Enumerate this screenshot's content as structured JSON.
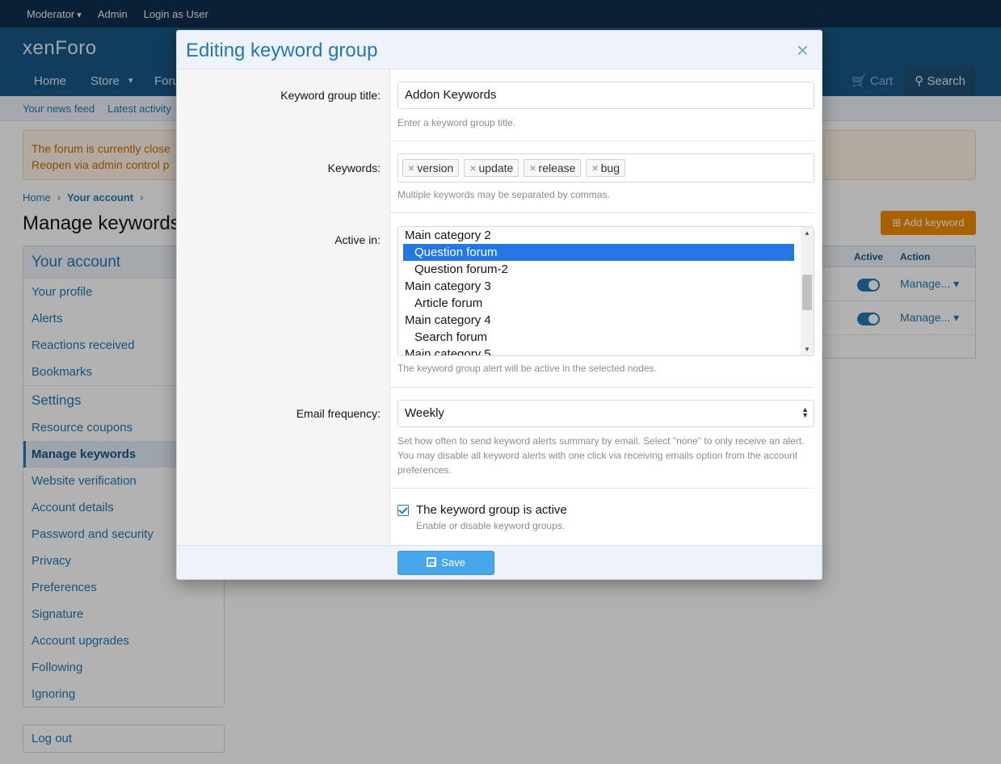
{
  "staffbar": {
    "items": [
      "Moderator",
      "Admin",
      "Login as User"
    ]
  },
  "header": {
    "logo": "xenForo"
  },
  "nav": {
    "tabs": [
      "Home",
      "Store",
      "Foru"
    ],
    "cart": "Cart",
    "search": "Search"
  },
  "subnav": {
    "items": [
      "Your news feed",
      "Latest activity"
    ]
  },
  "notice": {
    "line1": "The forum is currently close",
    "line2": "Reopen via admin control p"
  },
  "breadcrumb": {
    "home": "Home",
    "account": "Your account"
  },
  "page": {
    "title": "Manage keywords",
    "add_button": "Add keyword"
  },
  "table": {
    "col_active": "Active",
    "col_action": "Action",
    "rows": [
      {
        "action": "Manage..."
      },
      {
        "action": "Manage..."
      }
    ]
  },
  "sidebar": {
    "head": "Your account",
    "items": [
      "Your profile",
      "Alerts",
      "Reactions received",
      "Bookmarks"
    ],
    "settings_head": "Settings",
    "settings_items": [
      "Resource coupons",
      "Manage keywords",
      "Website verification",
      "Account details",
      "Password and security",
      "Privacy",
      "Preferences",
      "Signature",
      "Account upgrades",
      "Following",
      "Ignoring"
    ],
    "logout": "Log out"
  },
  "modal": {
    "title": "Editing keyword group",
    "close_icon": "×",
    "title_field": {
      "label": "Keyword group title:",
      "value": "Addon Keywords",
      "hint": "Enter a keyword group title."
    },
    "keywords_field": {
      "label": "Keywords:",
      "chips": [
        "version",
        "update",
        "release",
        "bug"
      ],
      "hint": "Multiple keywords may be separated by commas."
    },
    "active_in_field": {
      "label": "Active in:",
      "options": [
        {
          "label": "Main category 2",
          "child": false,
          "selected": false
        },
        {
          "label": "Question forum",
          "child": true,
          "selected": true
        },
        {
          "label": "Question forum-2",
          "child": true,
          "selected": false
        },
        {
          "label": "Main category 3",
          "child": false,
          "selected": false
        },
        {
          "label": "Article forum",
          "child": true,
          "selected": false
        },
        {
          "label": "Main category 4",
          "child": false,
          "selected": false
        },
        {
          "label": "Search forum",
          "child": true,
          "selected": false
        },
        {
          "label": "Main category 5",
          "child": false,
          "selected": false
        }
      ],
      "hint": "The keyword group alert will be active in the selected nodes."
    },
    "email_field": {
      "label": "Email frequency:",
      "value": "Weekly",
      "hint": "Set how often to send keyword alerts summary by email. Select \"none\" to only receive an alert. You may disable all keyword alerts with one click via receiving emails option from the account preferences."
    },
    "active_checkbox": {
      "checked": true,
      "label": "The keyword group is active",
      "hint": "Enable or disable keyword groups."
    },
    "save_label": "Save"
  }
}
